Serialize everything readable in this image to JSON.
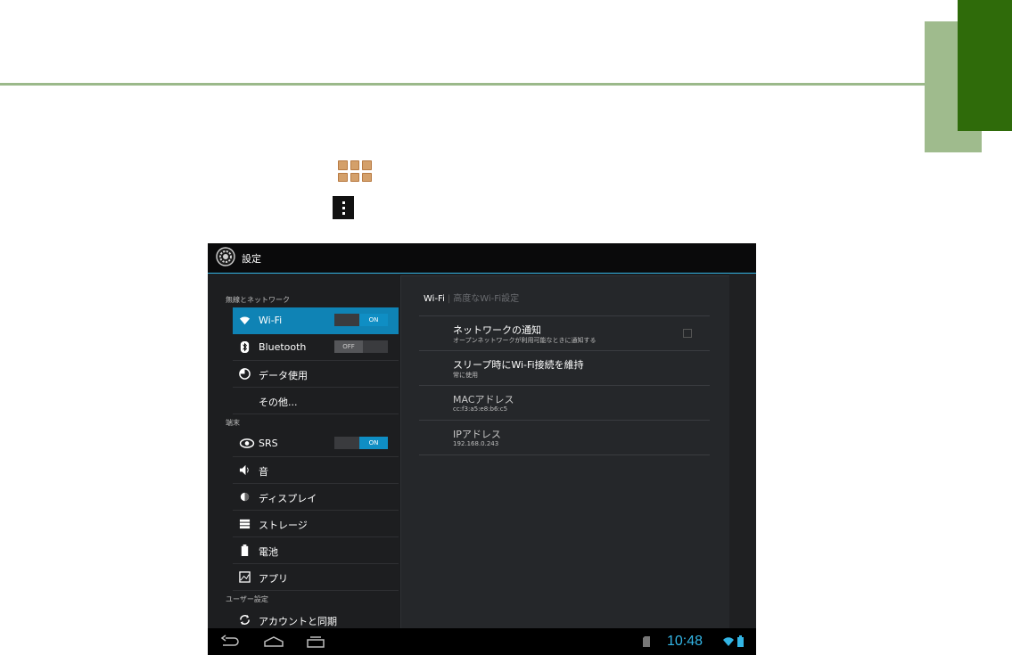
{
  "decor": {
    "accent_dark": "#2f6b0a",
    "accent_light": "#9fbb8d",
    "line": "#9bb98a"
  },
  "icons": {
    "apps": "apps-grid-icon",
    "menu": "overflow-menu-icon"
  },
  "screen": {
    "title": "設定",
    "accent": "#33b5e5",
    "sections": {
      "wireless": "無線とネットワーク",
      "device": "端末",
      "user": "ユーザー設定"
    },
    "items": [
      {
        "label": "Wi-Fi",
        "icon": "wifi-icon",
        "toggle": "ON",
        "selected": true
      },
      {
        "label": "Bluetooth",
        "icon": "bluetooth-icon",
        "toggle": "OFF"
      },
      {
        "label": "データ使用",
        "icon": "data-usage-icon"
      },
      {
        "label": "その他...",
        "icon": ""
      },
      {
        "label": "SRS",
        "icon": "srs-icon",
        "toggle": "ON"
      },
      {
        "label": "音",
        "icon": "sound-icon"
      },
      {
        "label": "ディスプレイ",
        "icon": "display-icon"
      },
      {
        "label": "ストレージ",
        "icon": "storage-icon"
      },
      {
        "label": "電池",
        "icon": "battery-icon"
      },
      {
        "label": "アプリ",
        "icon": "apps-icon"
      },
      {
        "label": "アカウントと同期",
        "icon": "sync-icon"
      }
    ],
    "right": {
      "tab_active": "Wi-Fi",
      "tab_inactive": "高度なWi-Fi設定",
      "prefs": [
        {
          "title": "ネットワークの通知",
          "summary": "オープンネットワークが利用可能なときに通知する"
        },
        {
          "title": "スリープ時にWi-Fi接続を維持",
          "summary": "常に使用"
        },
        {
          "title": "MACアドレス",
          "summary": "cc:f3:a5:e8:b6:c5"
        },
        {
          "title": "IPアドレス",
          "summary": "192.168.0.243"
        }
      ]
    },
    "clock": "10:48"
  }
}
